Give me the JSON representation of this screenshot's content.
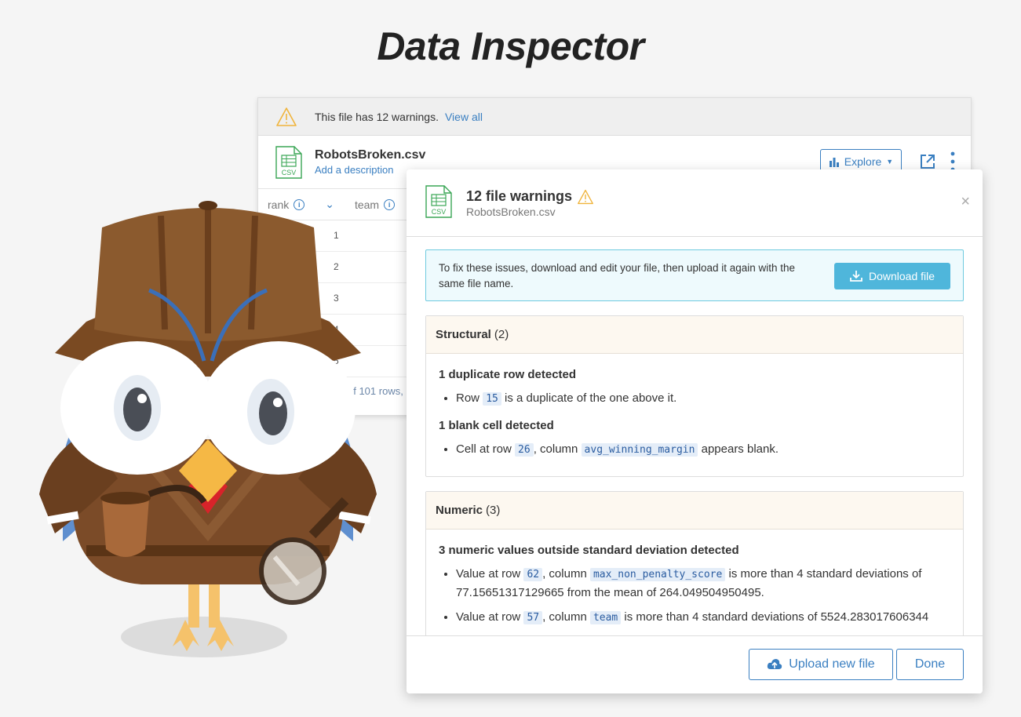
{
  "page": {
    "title": "Data Inspector"
  },
  "file_card": {
    "warning_message": "This file has 12 warnings.",
    "warning_link": "View all",
    "file_name": "RobotsBroken.csv",
    "file_description_link": "Add a description",
    "csv_badge": "CSV",
    "explore_label": "Explore",
    "columns": [
      {
        "label": "rank"
      },
      {
        "label": "team"
      }
    ],
    "row_numbers": [
      "1",
      "2",
      "3",
      "4",
      "5"
    ],
    "rows_summary": "of 101 rows,"
  },
  "modal": {
    "title": "12 file warnings",
    "subtitle": "RobotsBroken.csv",
    "csv_badge": "CSV",
    "close_glyph": "×",
    "info_text": "To fix these issues, download and edit your file, then upload it again with the same file name.",
    "download_label": "Download file",
    "sections": [
      {
        "title": "Structural",
        "count": "(2)",
        "groups": [
          {
            "heading": "1 duplicate row detected",
            "items": [
              {
                "pre": "Row ",
                "code1": "15",
                "mid": " is a duplicate of the one above it.",
                "code2": "",
                "post": ""
              }
            ]
          },
          {
            "heading": "1 blank cell detected",
            "items": [
              {
                "pre": "Cell at row ",
                "code1": "26",
                "mid": ", column ",
                "code2": "avg_winning_margin",
                "post": " appears blank."
              }
            ]
          }
        ]
      },
      {
        "title": "Numeric",
        "count": "(3)",
        "groups": [
          {
            "heading": "3 numeric values outside standard deviation detected",
            "items": [
              {
                "pre": "Value at row ",
                "code1": "62",
                "mid": ", column ",
                "code2": "max_non_penalty_score",
                "post": " is more than 4 standard deviations of 77.15651317129665 from the mean of 264.049504950495."
              },
              {
                "pre": "Value at row ",
                "code1": "57",
                "mid": ", column ",
                "code2": "team",
                "post": " is more than 4 standard deviations of 5524.283017606344"
              }
            ]
          }
        ]
      }
    ],
    "upload_label": "Upload new file",
    "done_label": "Done"
  },
  "colors": {
    "accent": "#3a7fc1",
    "download_button": "#4fb6db",
    "warning": "#f0b43c",
    "csv_green": "#3aa655"
  }
}
